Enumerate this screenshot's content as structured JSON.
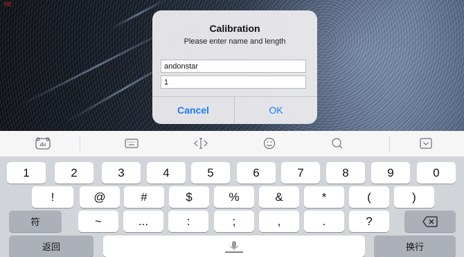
{
  "camera": {
    "label": "RE"
  },
  "dialog": {
    "title": "Calibration",
    "message": "Please enter name and length",
    "name_value": "andonstar",
    "length_value": "1",
    "cancel_label": "Cancel",
    "ok_label": "OK",
    "button_color": "#1a7cf5"
  },
  "toolbar": {
    "icons": [
      "baidu-logo-icon",
      "keyboard-icon",
      "cursor-move-icon",
      "emoji-icon",
      "search-icon",
      "hide-keyboard-icon"
    ],
    "logo_text": "du"
  },
  "keyboard": {
    "row1": [
      "1",
      "2",
      "3",
      "4",
      "5",
      "6",
      "7",
      "8",
      "9",
      "0"
    ],
    "row2": [
      "!",
      "@",
      "#",
      "$",
      "%",
      "&",
      "*",
      "(",
      ")"
    ],
    "row3": [
      "~",
      "...",
      ":",
      ";",
      ",",
      ".",
      "?"
    ],
    "symbol_key": "符",
    "back_key": "返回",
    "return_key": "换行"
  }
}
